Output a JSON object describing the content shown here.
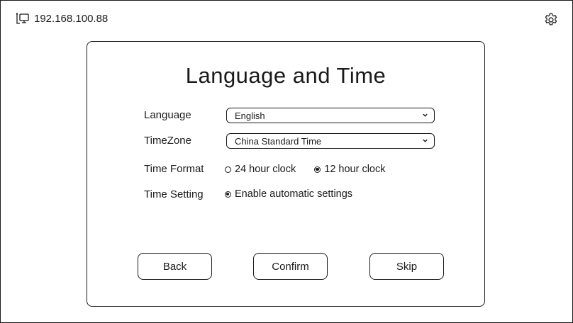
{
  "status": {
    "ip_address": "192.168.100.88",
    "network_icon": "network-computer-icon",
    "settings_icon": "gear-icon"
  },
  "dialog": {
    "title": "Language and Time",
    "language": {
      "label": "Language",
      "selected": "English"
    },
    "timezone": {
      "label": "TimeZone",
      "selected": "China Standard Time"
    },
    "time_format": {
      "label": "Time Format",
      "options": [
        {
          "label": "24 hour clock",
          "selected": false
        },
        {
          "label": "12 hour clock",
          "selected": true
        }
      ]
    },
    "time_setting": {
      "label": "Time Setting",
      "option": {
        "label": "Enable automatic settings",
        "selected": true
      }
    },
    "buttons": {
      "back": "Back",
      "confirm": "Confirm",
      "skip": "Skip"
    }
  }
}
